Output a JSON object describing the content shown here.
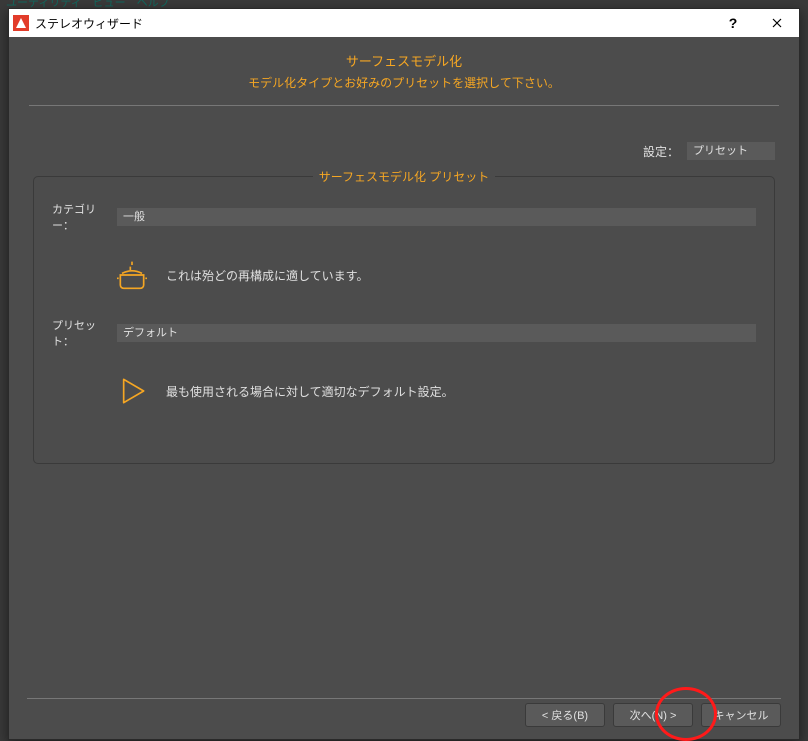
{
  "parent_menu": "ユーティリティ　ビュー　ヘルプ",
  "window": {
    "title": "ステレオウィザード"
  },
  "heading": {
    "title": "サーフェスモデル化",
    "subtitle": "モデル化タイプとお好みのプリセットを選択して下さい。"
  },
  "settings": {
    "label": "設定：",
    "value": "プリセット"
  },
  "groupbox": {
    "legend": "サーフェスモデル化 プリセット",
    "category": {
      "label": "カテゴリー：",
      "value": "一般",
      "description": "これは殆どの再構成に適しています。"
    },
    "preset": {
      "label": "プリセット：",
      "value": "デフォルト",
      "description": "最も使用される場合に対して適切なデフォルト設定。"
    }
  },
  "buttons": {
    "back": "< 戻る(B)",
    "next": "次へ(N) >",
    "cancel": "キャンセル"
  }
}
